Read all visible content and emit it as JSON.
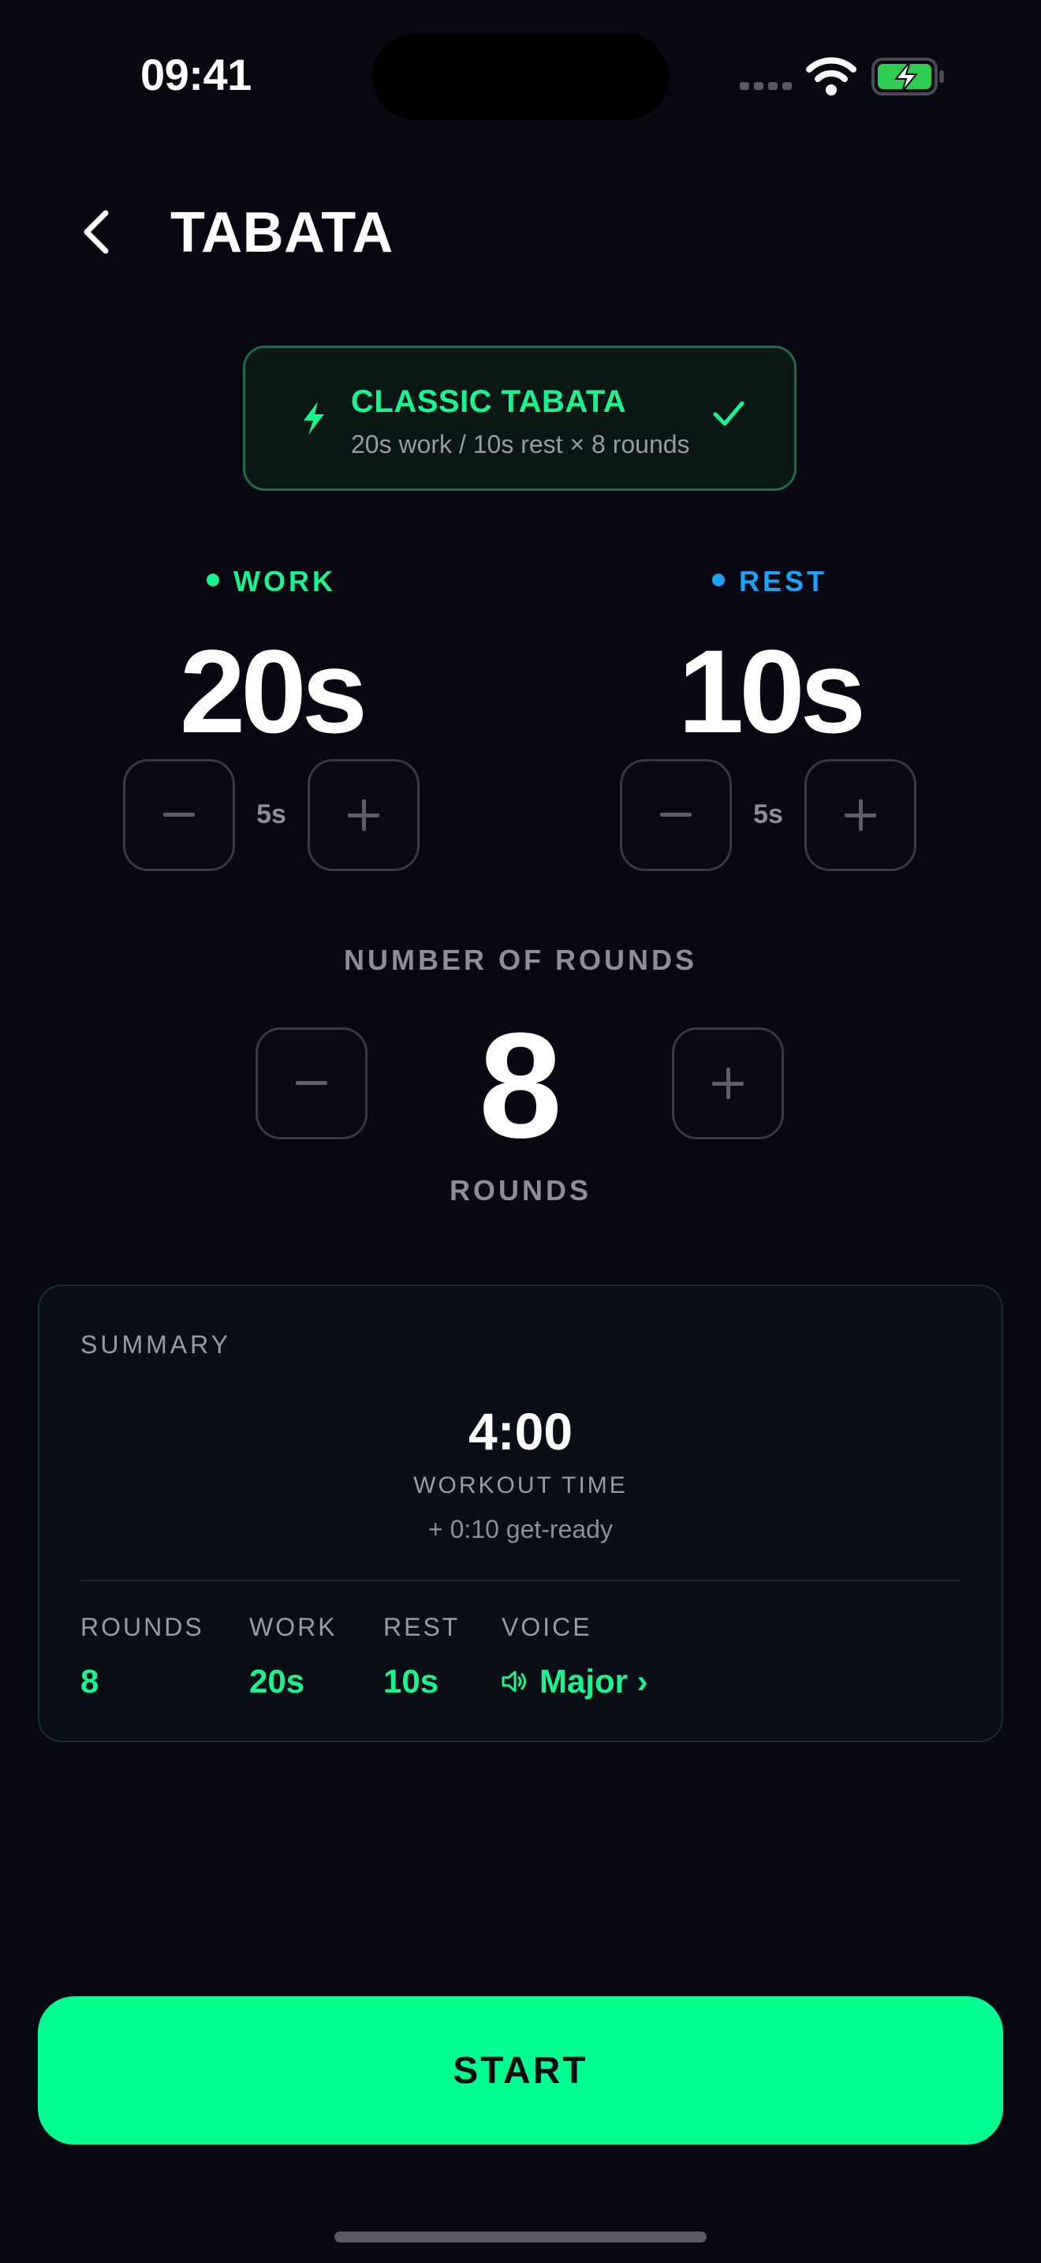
{
  "status_bar": {
    "time": "09:41"
  },
  "header": {
    "title": "TABATA"
  },
  "preset": {
    "title": "CLASSIC TABATA",
    "subtitle": "20s work / 10s rest × 8 rounds",
    "selected": true
  },
  "work": {
    "label": "WORK",
    "value": "20s",
    "step": "5s",
    "color": "#19f58e"
  },
  "rest": {
    "label": "REST",
    "value": "10s",
    "step": "5s",
    "color": "#1aa3ff"
  },
  "rounds": {
    "title": "NUMBER OF ROUNDS",
    "value": "8",
    "unit": "ROUNDS"
  },
  "summary": {
    "title": "SUMMARY",
    "total_time": "4:00",
    "total_time_label": "WORKOUT TIME",
    "get_ready": "+ 0:10 get-ready",
    "stats": {
      "rounds": {
        "label": "ROUNDS",
        "value": "8"
      },
      "work": {
        "label": "WORK",
        "value": "20s"
      },
      "rest": {
        "label": "REST",
        "value": "10s"
      },
      "voice": {
        "label": "VOICE",
        "value": "Major ›"
      }
    }
  },
  "start_button": {
    "label": "START"
  },
  "colors": {
    "accent": "#00ff8f",
    "background": "#080812",
    "rest_blue": "#1aa3ff"
  }
}
